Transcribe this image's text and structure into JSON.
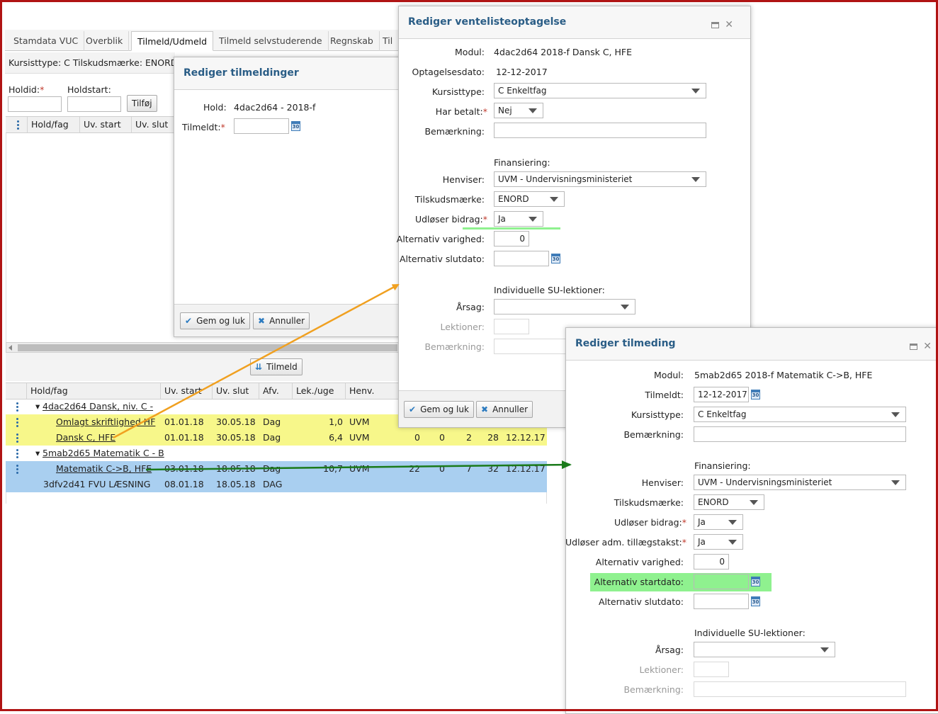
{
  "tabs": [
    "Stamdata VUC",
    "Overblik",
    "Tilmeld/Udmeld",
    "Tilmeld selvstuderende",
    "Regnskab",
    "Til"
  ],
  "info_line": "Kursisttype:  C  Tilskudsmærke: ENORD",
  "form": {
    "holdid_label": "Holdid:",
    "holdstart_label": "Holdstart:",
    "add_button": "Tilføj"
  },
  "upper_grid_headers": [
    "Hold/fag",
    "Uv. start",
    "Uv. slut"
  ],
  "tilmeld_button": "Tilmeld",
  "lower_grid": {
    "headers": [
      "Hold/fag",
      "Uv. start",
      "Uv. slut",
      "Afv.",
      "Lek./uge",
      "Henv."
    ],
    "rows": [
      {
        "group": "4dac2d64 Dansk, niv. C -"
      },
      {
        "name": "Omlagt skriftlighed HF",
        "start": "01.01.18",
        "end": "30.05.18",
        "afv": "Dag",
        "lek": "1,0",
        "henv": "UVM",
        "c1": "",
        "c2": "",
        "c3": "",
        "c4": "",
        "date": ""
      },
      {
        "name": "Dansk C, HFE",
        "start": "01.01.18",
        "end": "30.05.18",
        "afv": "Dag",
        "lek": "6,4",
        "henv": "UVM",
        "c1": "0",
        "c2": "0",
        "c3": "2",
        "c4": "28",
        "date": "12.12.17"
      },
      {
        "group": "5mab2d65 Matematik C - B"
      },
      {
        "name": "Matematik C->B, HFE",
        "start": "03.01.18",
        "end": "18.05.18",
        "afv": "Dag",
        "lek": "10,7",
        "henv": "UVM",
        "c1": "22",
        "c2": "0",
        "c3": "7",
        "c4": "32",
        "date": "12.12.17"
      },
      {
        "name": "3dfv2d41 FVU LÆSNING",
        "start": "08.01.18",
        "end": "18.05.18",
        "afv": "DAG",
        "lek": "",
        "henv": "",
        "c1": "",
        "c2": "",
        "c3": "",
        "c4": "",
        "date": ""
      }
    ]
  },
  "dialog_tilmeldinger": {
    "title": "Rediger tilmeldinger",
    "hold_label": "Hold:",
    "hold_value": "4dac2d64 - 2018-f",
    "tilmeldt_label": "Tilmeldt:",
    "save_button": "Gem og luk",
    "cancel_button": "Annuller"
  },
  "dialog_venteliste": {
    "title": "Rediger ventelisteoptagelse",
    "modul_label": "Modul:",
    "modul_value": "4dac2d64 2018-f Dansk C, HFE",
    "optagelsesdato_label": "Optagelsesdato:",
    "optagelsesdato_value": "12-12-2017",
    "kursisttype_label": "Kursisttype:",
    "kursisttype_value": "C Enkeltfag",
    "har_betalt_label": "Har betalt:",
    "har_betalt_value": "Nej",
    "bemaerkning_label": "Bemærkning:",
    "finansiering_heading": "Finansiering:",
    "henviser_label": "Henviser:",
    "henviser_value": "UVM - Undervisningsministeriet",
    "tilskudsmaerke_label": "Tilskudsmærke:",
    "tilskudsmaerke_value": "ENORD",
    "udloser_bidrag_label": "Udløser bidrag:",
    "udloser_bidrag_value": "Ja",
    "alt_varighed_label": "Alternativ varighed:",
    "alt_varighed_value": "0",
    "alt_slutdato_label": "Alternativ slutdato:",
    "su_heading": "Individuelle SU-lektioner:",
    "aarsag_label": "Årsag:",
    "lektioner_label": "Lektioner:",
    "bemaerkning2_label": "Bemærkning:",
    "save_button": "Gem og luk",
    "cancel_button": "Annuller"
  },
  "dialog_tilmeding": {
    "title": "Rediger tilmeding",
    "modul_label": "Modul:",
    "modul_value": "5mab2d65 2018-f Matematik C->B, HFE",
    "tilmeldt_label": "Tilmeldt:",
    "tilmeldt_value": "12-12-2017",
    "kursisttype_label": "Kursisttype:",
    "kursisttype_value": "C Enkeltfag",
    "bemaerkning_label": "Bemærkning:",
    "finansiering_heading": "Finansiering:",
    "henviser_label": "Henviser:",
    "henviser_value": "UVM - Undervisningsministeriet",
    "tilskudsmaerke_label": "Tilskudsmærke:",
    "tilskudsmaerke_value": "ENORD",
    "udloser_bidrag_label": "Udløser bidrag:",
    "udloser_bidrag_value": "Ja",
    "udloser_adm_label": "Udløser adm. tillægstakst:",
    "udloser_adm_value": "Ja",
    "alt_varighed_label": "Alternativ varighed:",
    "alt_varighed_value": "0",
    "alt_startdato_label": "Alternativ startdato:",
    "alt_slutdato_label": "Alternativ slutdato:",
    "su_heading": "Individuelle SU-lektioner:",
    "aarsag_label": "Årsag:",
    "lektioner_label": "Lektioner:",
    "bemaerkning2_label": "Bemærkning:"
  },
  "calendar_icon_text": "30",
  "colors": {
    "frame": "#b01414",
    "dialog_title": "#2a5d86",
    "highlight_yellow": "#f7f78a",
    "highlight_blue": "#a9cff0",
    "highlight_green": "#8ff18f",
    "arrow_orange": "#f0a020",
    "arrow_green": "#1a7a1a"
  },
  "icons": [
    "row-menu-icon",
    "calendar-icon",
    "checkmark-icon",
    "cancel-x-icon",
    "dropdown-arrow-icon",
    "maximize-icon",
    "close-icon",
    "expand-triangle-icon",
    "down-arrow-icon"
  ]
}
